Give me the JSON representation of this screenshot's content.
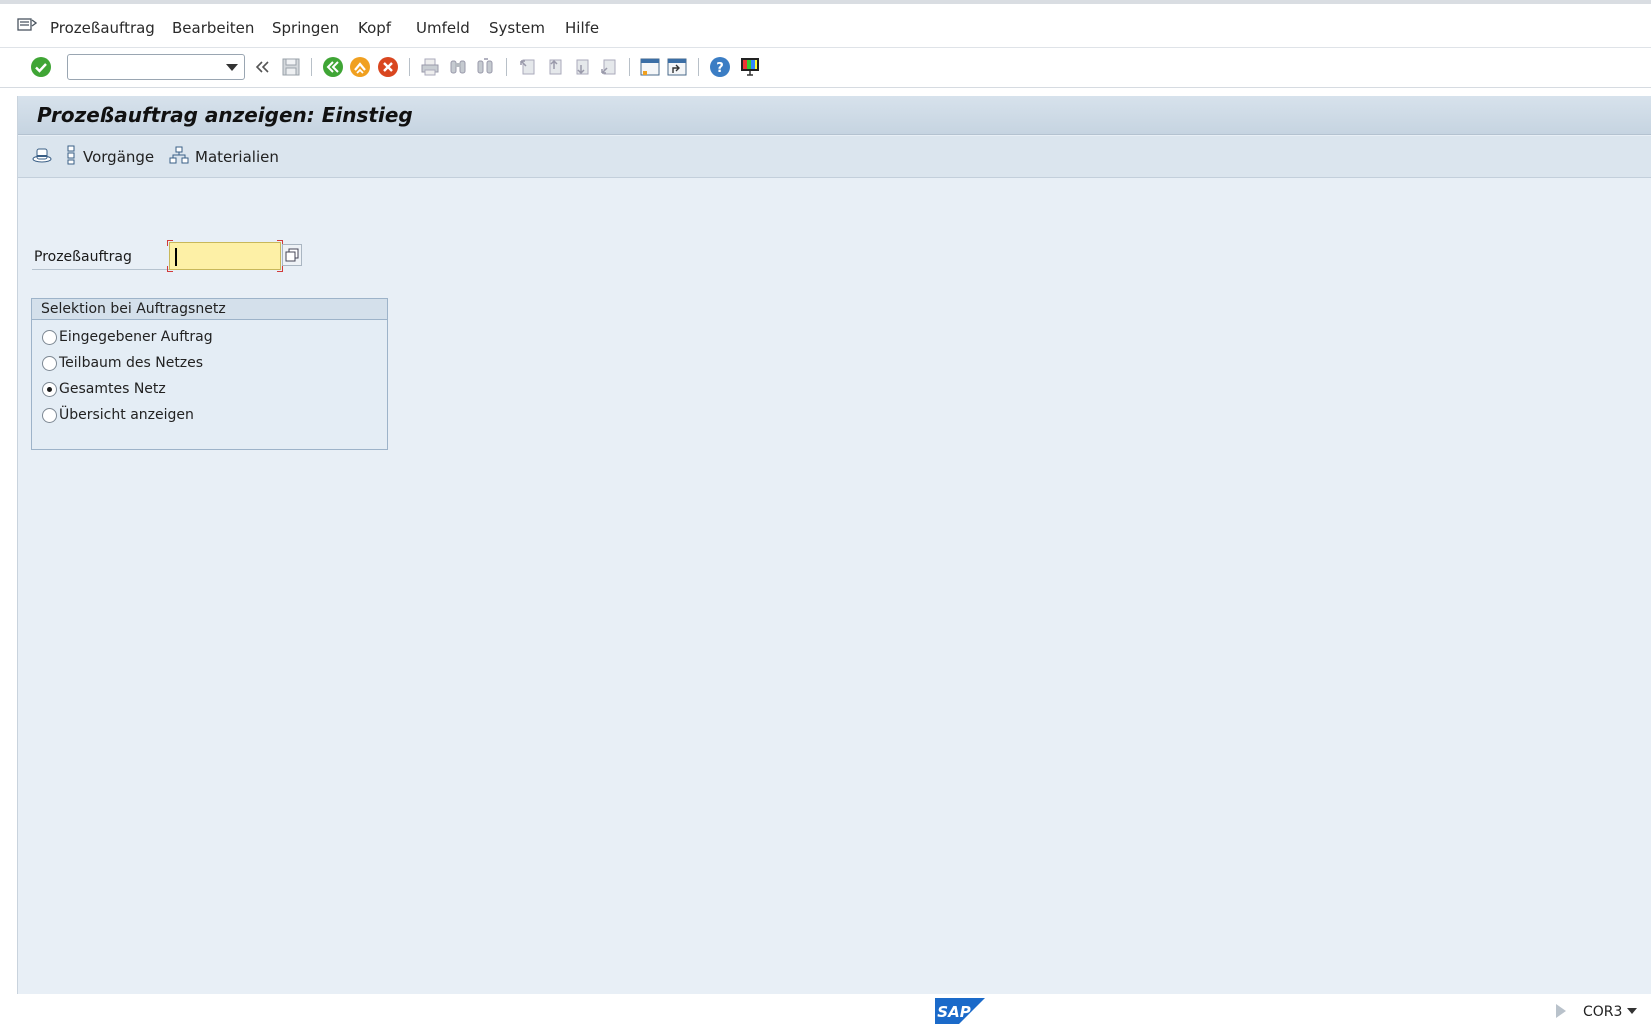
{
  "menubar": {
    "items": [
      {
        "label": "Prozeßauftrag"
      },
      {
        "label": "Bearbeiten"
      },
      {
        "label": "Springen"
      },
      {
        "label": "Kopf"
      },
      {
        "label": "Umfeld"
      },
      {
        "label": "System"
      },
      {
        "label": "Hilfe"
      }
    ]
  },
  "toolbar": {
    "command_field_value": "",
    "icons": [
      "enter-icon",
      "back-double-icon",
      "save-icon",
      "back-icon",
      "exit-icon",
      "cancel-icon",
      "print-icon",
      "find-icon",
      "find-next-icon",
      "first-page-icon",
      "previous-page-icon",
      "next-page-icon",
      "last-page-icon",
      "new-session-icon",
      "create-shortcut-icon",
      "help-icon",
      "customize-layout-icon"
    ]
  },
  "screen": {
    "title": "Prozeßauftrag anzeigen: Einstieg",
    "app_toolbar": {
      "operations_label": "Vorgänge",
      "materials_label": "Materialien"
    }
  },
  "form": {
    "order_label": "Prozeßauftrag",
    "order_value": ""
  },
  "selection": {
    "title": "Selektion bei Auftragsnetz",
    "options": [
      {
        "label": "Eingegebener Auftrag",
        "checked": false
      },
      {
        "label": "Teilbaum des Netzes",
        "checked": false
      },
      {
        "label": "Gesamtes Netz",
        "checked": true
      },
      {
        "label": "Übersicht anzeigen",
        "checked": false
      }
    ]
  },
  "status": {
    "logo_text": "SAP",
    "system": "COR3"
  },
  "colors": {
    "frame_bg": "#e8eff6",
    "title_bar": "#c6d4e1",
    "required_field": "#fdf0a6",
    "sap_blue": "#1b6ac9"
  }
}
